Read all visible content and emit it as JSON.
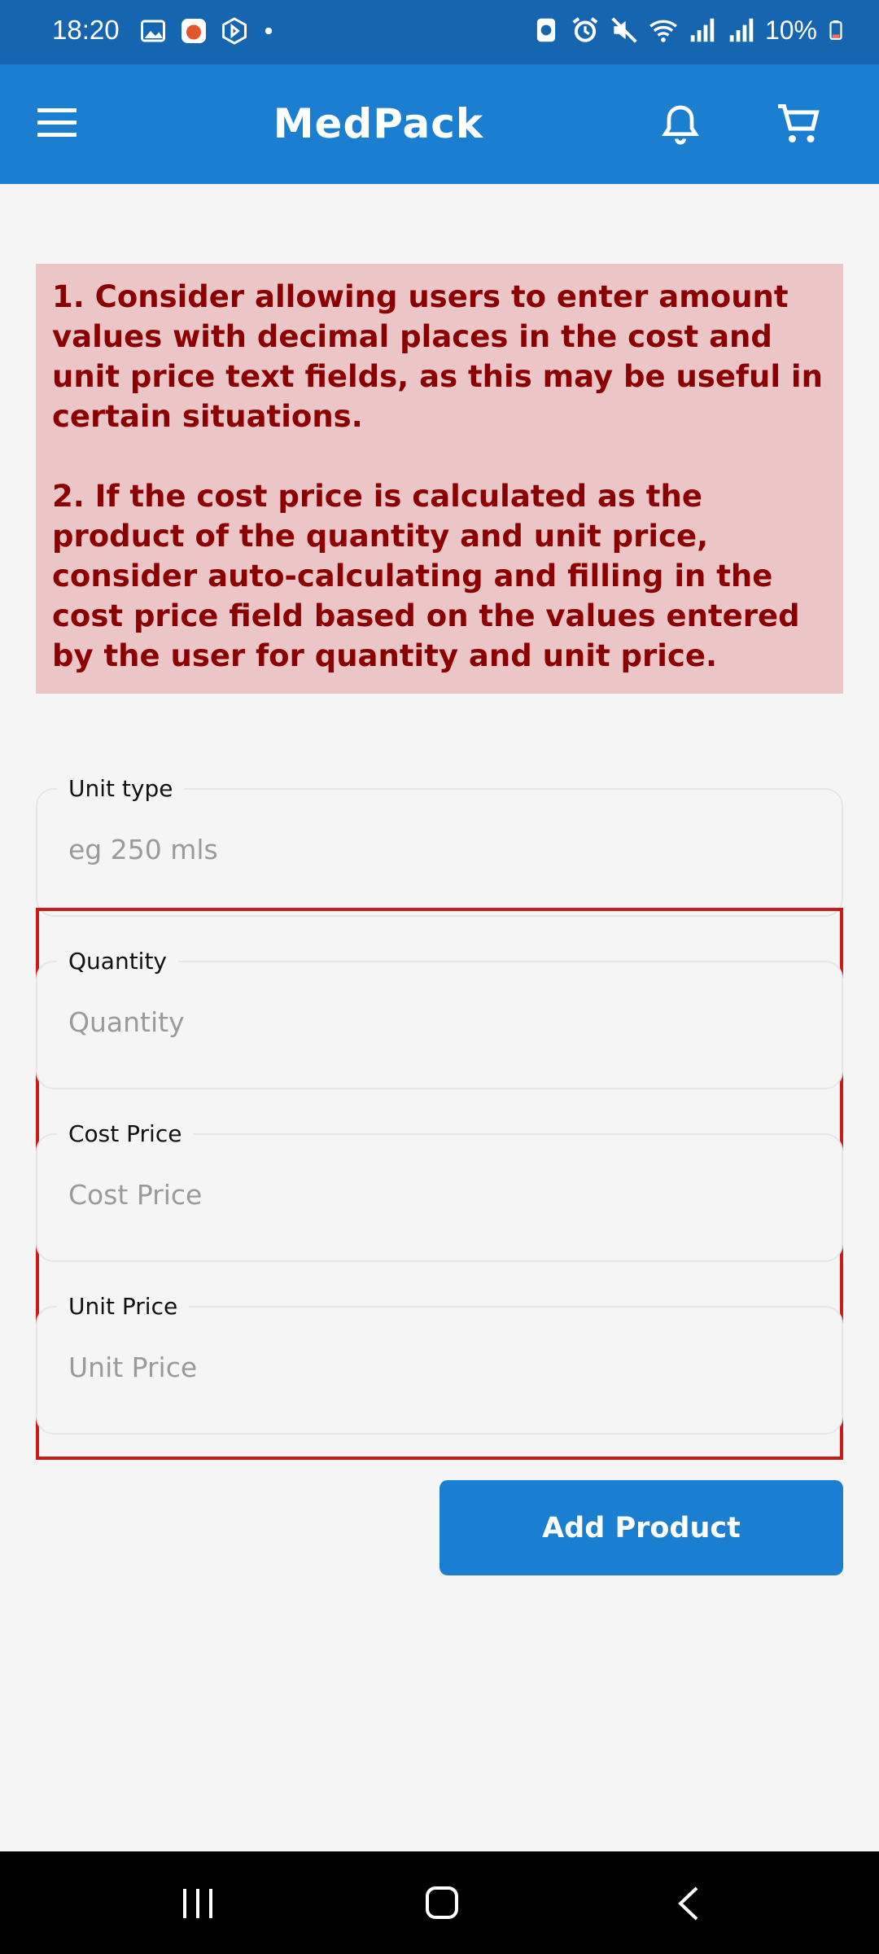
{
  "status_bar": {
    "time": "18:20",
    "battery": "10%",
    "left_icons": [
      "gallery-icon",
      "app-notification-icon",
      "bing-icon",
      "dot-icon"
    ],
    "right_icons": [
      "data-saver-icon",
      "alarm-icon",
      "mute-icon",
      "wifi-icon",
      "signal-icon",
      "signal-icon",
      "battery-icon"
    ]
  },
  "app_bar": {
    "title": "MedPack",
    "icons": [
      "menu-icon",
      "bell-icon",
      "cart-icon"
    ]
  },
  "feedback": {
    "items": [
      "1. Consider allowing users to enter amount values with decimal places in the cost and unit price text fields, as this may be useful in certain situations.",
      "2. If the cost price is calculated as the product of the quantity and unit price, consider auto-calculating and filling in the cost price field based on the values entered by the user for quantity and unit price."
    ],
    "colors": {
      "background": "#ecc6c7",
      "text": "#8b0000"
    }
  },
  "form": {
    "unit_type": {
      "label": "Unit type",
      "placeholder": "eg 250 mls",
      "value": ""
    },
    "quantity": {
      "label": "Quantity",
      "placeholder": "Quantity",
      "value": ""
    },
    "cost_price": {
      "label": "Cost Price",
      "placeholder": "Cost Price",
      "value": ""
    },
    "unit_price": {
      "label": "Unit Price",
      "placeholder": "Unit Price",
      "value": ""
    },
    "submit_label": "Add Product"
  },
  "colors": {
    "primary": "#1a7fd1",
    "status_bar": "#1565b0",
    "highlight": "#cc1a1a"
  }
}
